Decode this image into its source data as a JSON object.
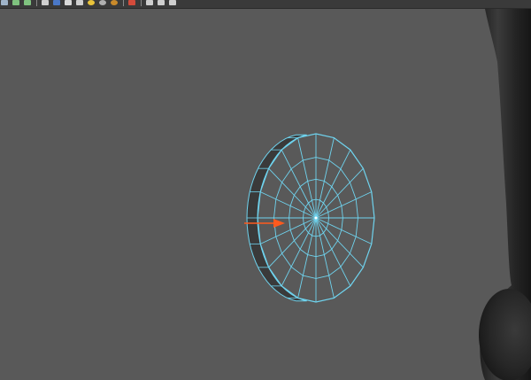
{
  "toolbar": {
    "buttons": [
      {
        "name": "select-tool-button",
        "icon": "select-icon",
        "color": "#9fb3c8"
      },
      {
        "name": "move-tool-button",
        "icon": "move-icon",
        "color": "#7fc27f"
      },
      {
        "name": "rotate-tool-button",
        "icon": "rotate-icon",
        "color": "#7fc27f"
      },
      {
        "name": "wireframe-shading-button",
        "icon": "wireframe-cube-icon",
        "color": "#cfcfcf"
      },
      {
        "name": "smooth-shading-button",
        "icon": "shaded-cube-icon",
        "color": "#4a78c8"
      },
      {
        "name": "textured-button",
        "icon": "textured-icon",
        "color": "#d9d9d9"
      },
      {
        "name": "lighting-button",
        "icon": "settings-gear-icon",
        "color": "#cfcfcf"
      },
      {
        "name": "default-light-button",
        "icon": "light-bulb-icon",
        "color": "#e8c23a"
      },
      {
        "name": "all-lights-button",
        "icon": "light-sphere-icon",
        "color": "#b0b0b0"
      },
      {
        "name": "shadows-button",
        "icon": "shadow-sphere-icon",
        "color": "#c98a2a"
      },
      {
        "name": "xray-button",
        "icon": "xray-icon",
        "color": "#d34b3b"
      },
      {
        "name": "isolate-select-button",
        "icon": "isolate-icon",
        "color": "#cfcfcf"
      },
      {
        "name": "resolution-gate-button",
        "icon": "resolution-gate-icon",
        "color": "#cfcfcf"
      },
      {
        "name": "camera-attributes-button",
        "icon": "wrench-icon",
        "color": "#cfcfcf"
      }
    ]
  },
  "scene": {
    "background_color": "#595959",
    "wire_color": "#6fd3ee",
    "manipulator_color": "#ff5a1e"
  }
}
